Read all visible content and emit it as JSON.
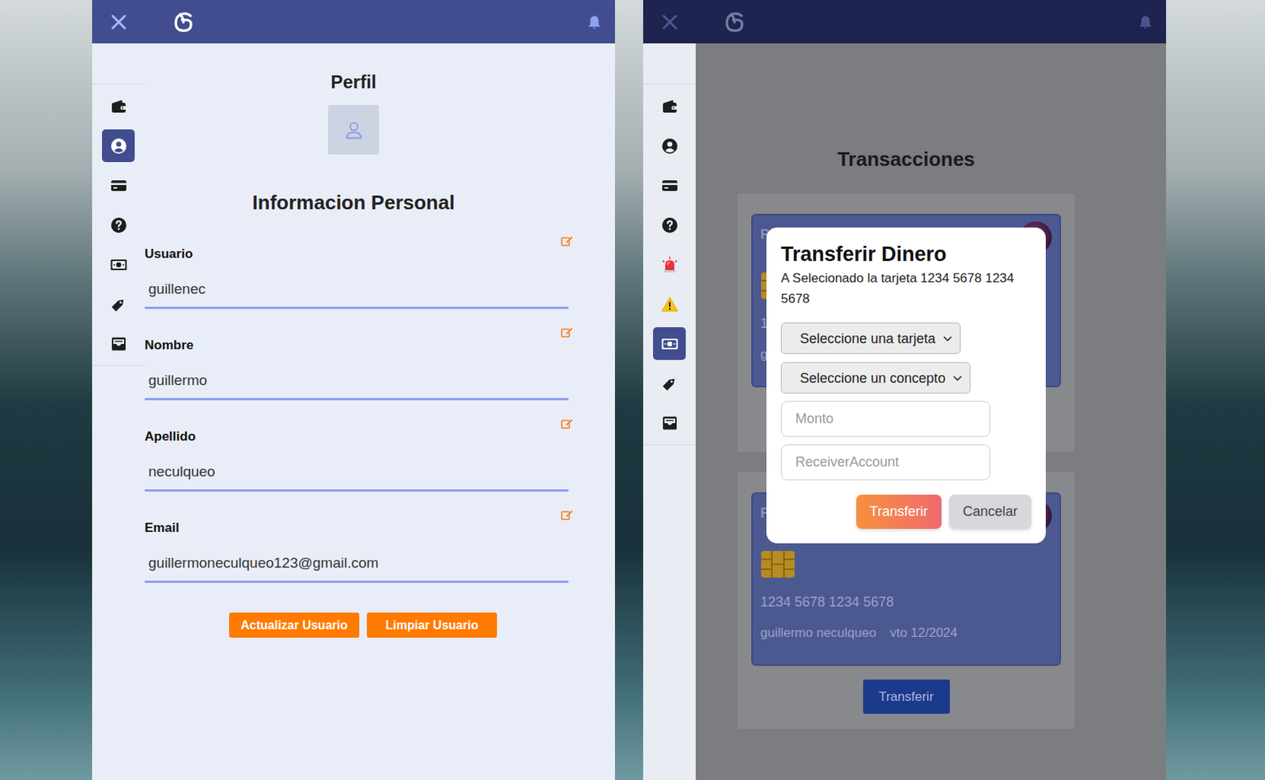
{
  "profile_panel": {
    "sidebar": [
      {
        "kind": "wallet",
        "selected": false
      },
      {
        "kind": "user",
        "selected": true
      },
      {
        "kind": "card",
        "selected": false
      },
      {
        "kind": "help",
        "selected": false
      },
      {
        "kind": "money",
        "selected": false
      },
      {
        "kind": "tag",
        "selected": false
      },
      {
        "kind": "inbox",
        "selected": false
      }
    ],
    "title": "Perfil",
    "section_title": "Informacion Personal",
    "fields": [
      {
        "label": "Usuario",
        "value": "guillenec"
      },
      {
        "label": "Nombre",
        "value": "guillermo"
      },
      {
        "label": "Apellido",
        "value": "neculqueo"
      },
      {
        "label": "Email",
        "value": "guillermoneculqueo123@gmail.com"
      }
    ],
    "buttons": [
      "Actualizar Usuario",
      "Limpiar Usuario"
    ]
  },
  "transactions_panel": {
    "sidebar": [
      {
        "kind": "wallet",
        "selected": false
      },
      {
        "kind": "user",
        "selected": false
      },
      {
        "kind": "card",
        "selected": false
      },
      {
        "kind": "help",
        "selected": false
      },
      {
        "kind": "siren",
        "selected": false
      },
      {
        "kind": "warning",
        "selected": false
      },
      {
        "kind": "money",
        "selected": true
      },
      {
        "kind": "tag",
        "selected": false
      },
      {
        "kind": "inbox",
        "selected": false
      }
    ],
    "title": "Transacciones",
    "cards": [
      {
        "label": "P",
        "number": "1",
        "holder": "g"
      },
      {
        "label": "P",
        "number": "1234 5678 1234 5678",
        "holder": "guillermo neculqueo",
        "expiry": "vto 12/2024",
        "button": "Transferir"
      }
    ]
  },
  "modal": {
    "title": "Transferir Dinero",
    "message": "A Selecionado la tarjeta 1234 5678 1234 5678",
    "selects": [
      "Seleccione una tarjeta",
      "Seleccione un concepto"
    ],
    "inputs": [
      {
        "placeholder": "Monto"
      },
      {
        "placeholder": "ReceiverAccount"
      }
    ],
    "buttons": [
      {
        "label": "Transferir",
        "kind": "primary"
      },
      {
        "label": "Cancelar",
        "kind": "secondary"
      }
    ]
  }
}
